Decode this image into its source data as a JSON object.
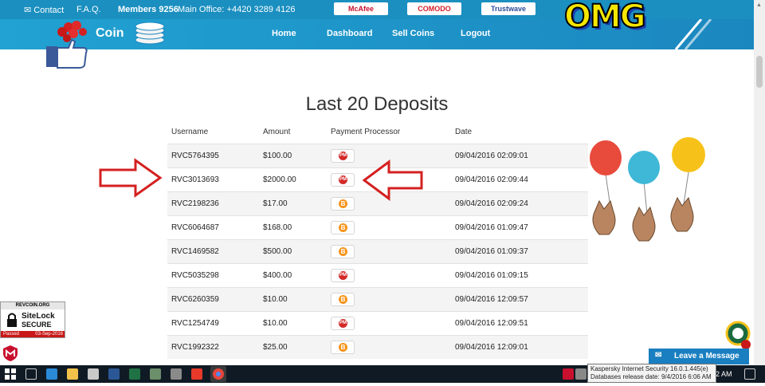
{
  "topbar": {
    "contact": "Contact",
    "faq": "F.A.Q.",
    "members_label": "Members",
    "members_count": "9256",
    "office": "Main Office: +4420 3289 4126",
    "badges": [
      "McAfee",
      "COMODO",
      "Trustwave"
    ]
  },
  "header": {
    "logo_text": "Coin",
    "nav": [
      "Home",
      "Dashboard",
      "Sell Coins",
      "Logout"
    ],
    "omg": "OMG"
  },
  "page": {
    "title": "Last 20 Deposits",
    "columns": [
      "Username",
      "Amount",
      "Payment Processor",
      "Date"
    ]
  },
  "deposits": [
    {
      "username": "RVC5764395",
      "amount": "$100.00",
      "processor": "PM",
      "date": "09/04/2016 02:09:01"
    },
    {
      "username": "RVC3013693",
      "amount": "$2000.00",
      "processor": "PM",
      "date": "09/04/2016 02:09:44"
    },
    {
      "username": "RVC2198236",
      "amount": "$17.00",
      "processor": "B",
      "date": "09/04/2016 02:09:24"
    },
    {
      "username": "RVC6064687",
      "amount": "$168.00",
      "processor": "B",
      "date": "09/04/2016 01:09:47"
    },
    {
      "username": "RVC1469582",
      "amount": "$500.00",
      "processor": "B",
      "date": "09/04/2016 01:09:37"
    },
    {
      "username": "RVC5035298",
      "amount": "$400.00",
      "processor": "PM",
      "date": "09/04/2016 01:09:15"
    },
    {
      "username": "RVC6260359",
      "amount": "$10.00",
      "processor": "B",
      "date": "09/04/2016 12:09:57"
    },
    {
      "username": "RVC1254749",
      "amount": "$10.00",
      "processor": "PM",
      "date": "09/04/2016 12:09:51"
    },
    {
      "username": "RVC1992322",
      "amount": "$25.00",
      "processor": "B",
      "date": "09/04/2016 12:09:01"
    }
  ],
  "sitelock": {
    "site": "REVCOIN.ORG",
    "brand1": "SiteLock",
    "brand2": "SECURE",
    "passed": "Passed",
    "date": "03-Sep-2016"
  },
  "chat": {
    "label": "Leave a Message"
  },
  "tooltip": {
    "line1": "Kaspersky Internet Security 16.0.1.445(e)",
    "line2": "Databases release date: 9/4/2016 6:06 AM"
  },
  "taskbar": {
    "time": "2 AM"
  }
}
